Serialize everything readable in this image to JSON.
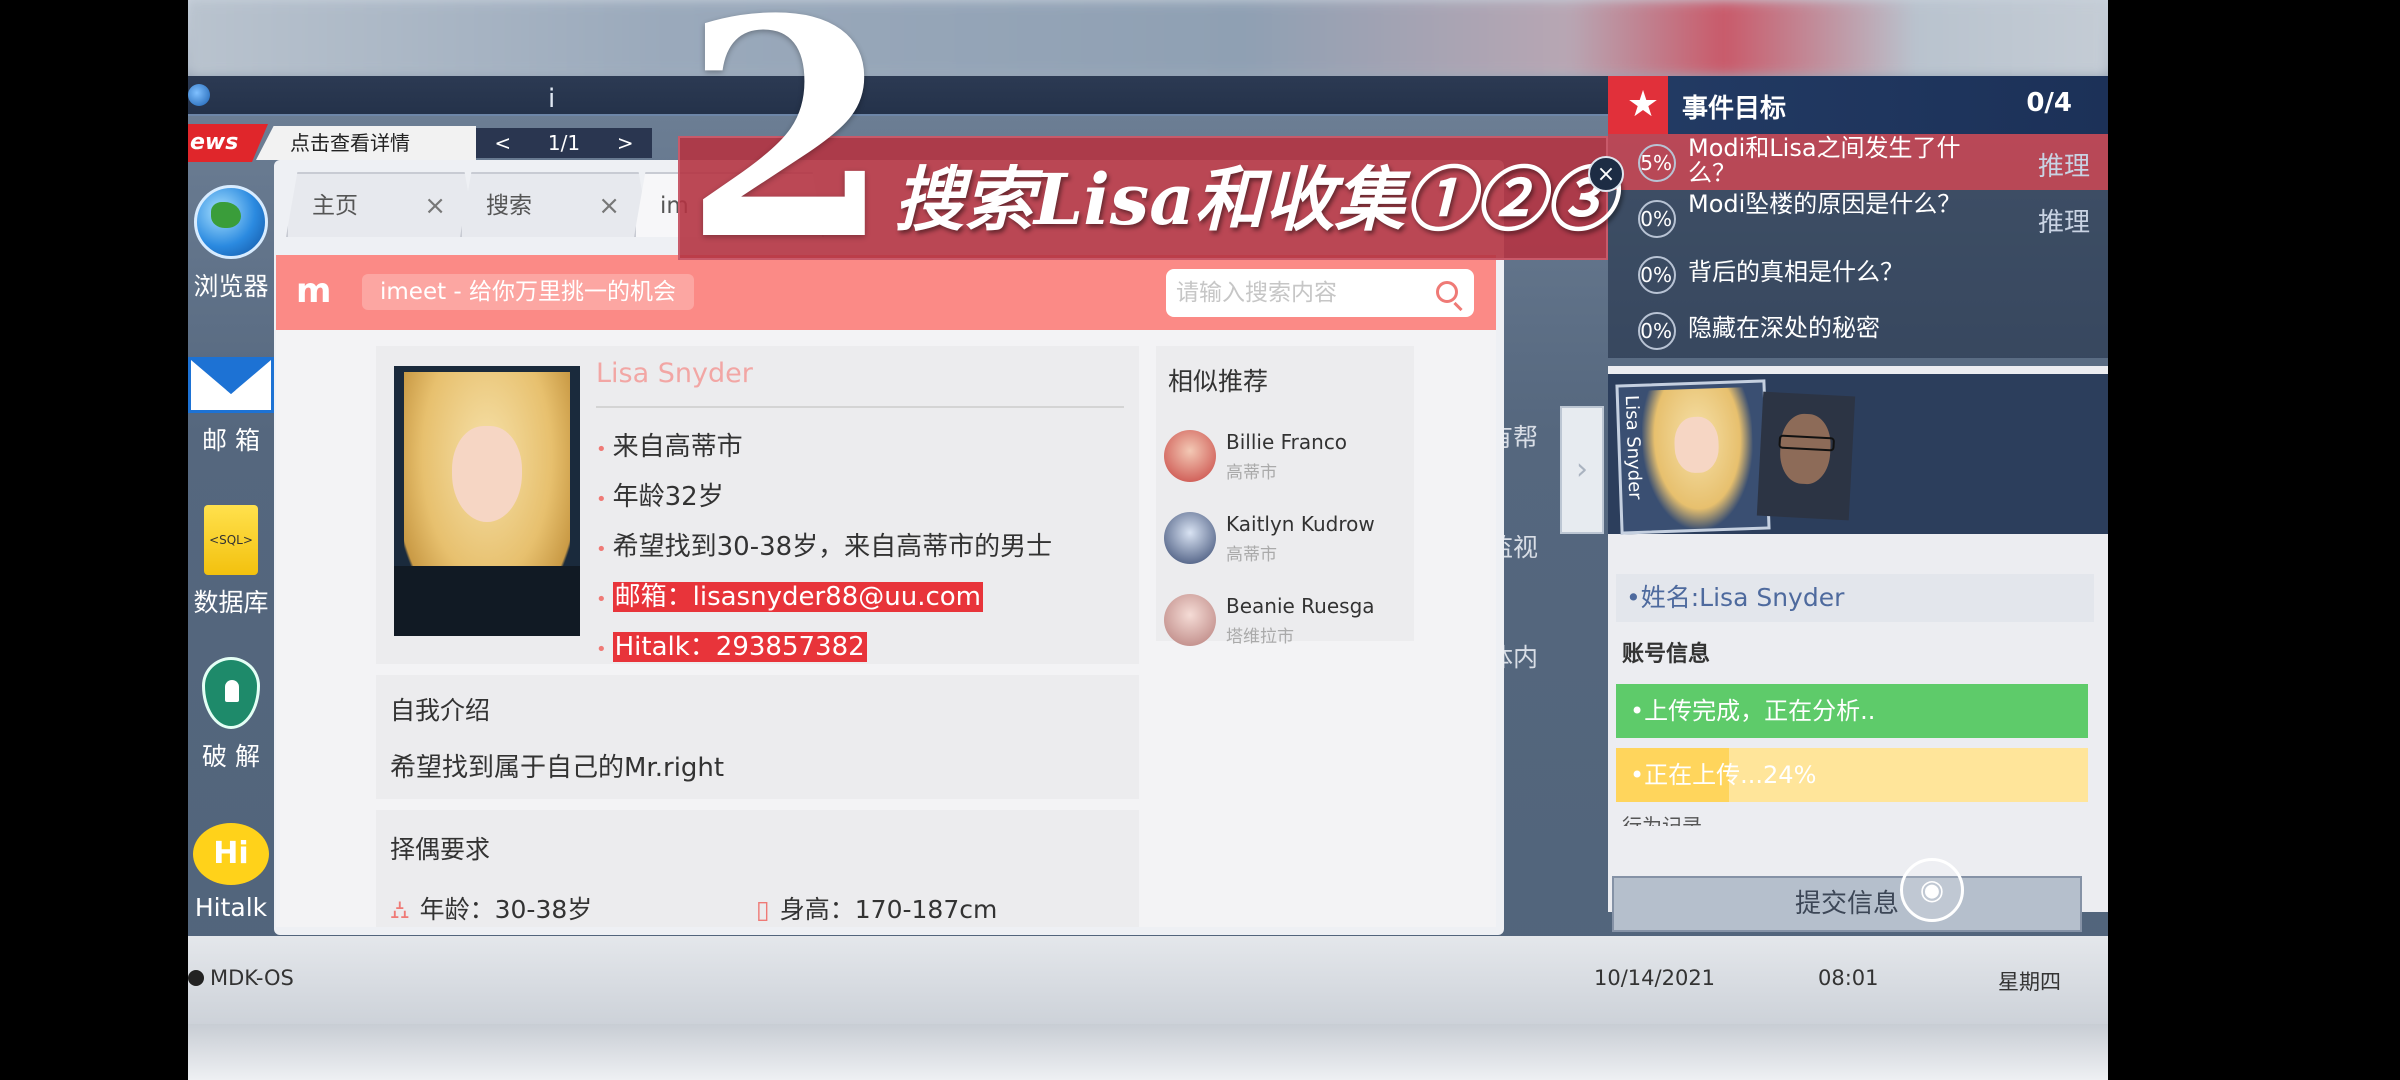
{
  "top": {
    "indicator": "i"
  },
  "news": {
    "badge": "ews",
    "text": "点击查看详情",
    "prev": "<",
    "page": "1/1",
    "next": ">"
  },
  "sidebar": [
    {
      "name": "browser",
      "label": "浏览器"
    },
    {
      "name": "mail",
      "label": "邮 箱"
    },
    {
      "name": "database",
      "label": "数据库",
      "icon_text": "<SQL>"
    },
    {
      "name": "crack",
      "label": "破 解"
    },
    {
      "name": "hitalk",
      "label": "Hitalk",
      "icon_text": "Hi"
    }
  ],
  "browser": {
    "tabs": [
      {
        "label": "主页",
        "close": "×"
      },
      {
        "label": "搜索",
        "close": "×"
      },
      {
        "label": "im"
      }
    ]
  },
  "imeet": {
    "logo": "m",
    "slogan": "imeet - 给你万里挑一的机会",
    "search_placeholder": "请输入搜索内容"
  },
  "profile": {
    "name": "Lisa Snyder",
    "items": [
      "来自高蒂市",
      "年龄32岁",
      "希望找到30-38岁，来自高蒂市的男士"
    ],
    "email": "邮箱：lisasnyder88@uu.com",
    "hitalk": "Hitalk：293857382",
    "intro_title": "自我介绍",
    "intro_text": "希望找到属于自己的Mr.right",
    "req_title": "择偶要求",
    "req_age": "年龄：30-38岁",
    "req_height": "身高：170-187cm"
  },
  "similar": {
    "title": "相似推荐",
    "items": [
      {
        "name": "Billie Franco",
        "city": "高蒂市"
      },
      {
        "name": "Kaitlyn Kudrow",
        "city": "高蒂市"
      },
      {
        "name": "Beanie Ruesga",
        "city": "塔维拉市"
      }
    ]
  },
  "background_text": [
    "有帮",
    "监视",
    "体内"
  ],
  "objectives": {
    "title": "事件目标",
    "count": "0/4",
    "items": [
      {
        "pct": "5%",
        "question": "Modi和Lisa之间发生了什么？",
        "tag": "推理",
        "active": true
      },
      {
        "pct": "0%",
        "question": "Modi坠楼的原因是什么？",
        "tag": "推理",
        "active": false
      },
      {
        "pct": "0%",
        "question": "背后的真相是什么？",
        "tag": "",
        "active": false
      },
      {
        "pct": "0%",
        "question": "隐藏在深处的秘密",
        "tag": "",
        "active": false
      }
    ]
  },
  "evidence": {
    "card_label": "Lisa Snyder",
    "name_field": "•姓名:Lisa Snyder",
    "account_header": "账号信息",
    "upload_done": "•上传完成，正在分析..",
    "uploading": "•正在上传...24%",
    "upload_progress": 0.24,
    "next_header": "行为记录",
    "submit": "提交信息"
  },
  "taskbar": {
    "os": "MDK-OS",
    "date": "10/14/2021",
    "time": "08:01",
    "weekday": "星期四"
  },
  "overlay": {
    "number": "2",
    "text": "搜索Lisa和收集①②③",
    "close": "×"
  },
  "colors": {
    "accent_red": "#e1303a",
    "imeet_pink": "#fb8a86",
    "navy": "#223a63",
    "green": "#5ecb6a",
    "yellow": "#ffe59a"
  }
}
